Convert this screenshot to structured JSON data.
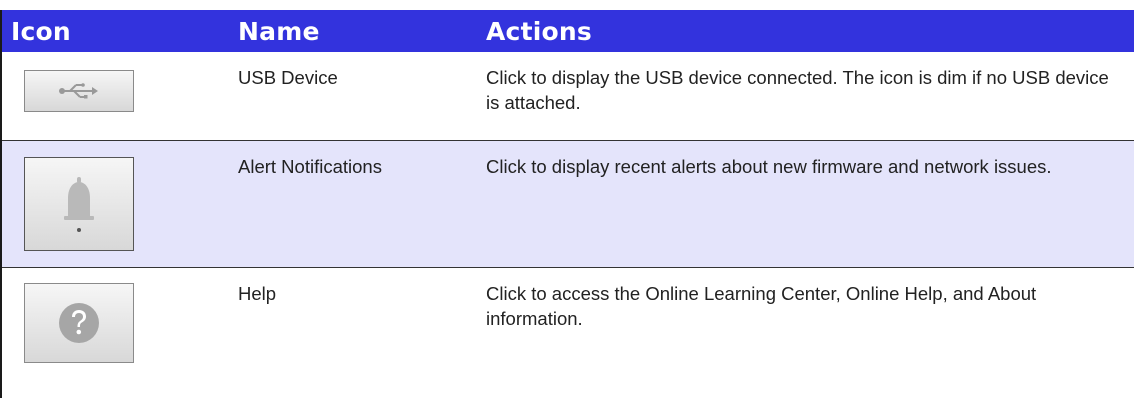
{
  "table": {
    "headers": {
      "icon": "Icon",
      "name": "Name",
      "actions": "Actions"
    },
    "rows": [
      {
        "icon": "usb-icon",
        "name": "USB Device",
        "action": "Click to display the USB device connected. The icon is dim if no USB device is attached."
      },
      {
        "icon": "bell-icon",
        "name": "Alert Notifications",
        "action": "Click to display recent alerts about new firmware and network issues."
      },
      {
        "icon": "help-icon",
        "name": "Help",
        "action": "Click to access the Online Learning Center, Online Help, and About information."
      }
    ]
  },
  "colors": {
    "header_bg": "#3333dd",
    "header_text": "#ffffff",
    "shaded_row": "#e4e4fb"
  }
}
